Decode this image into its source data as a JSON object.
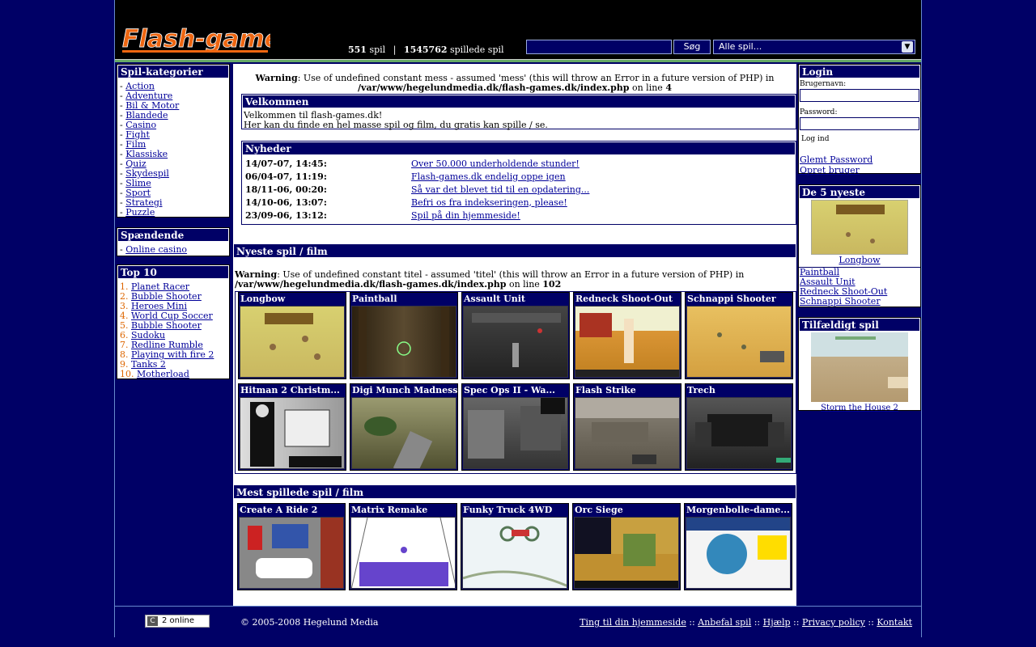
{
  "header": {
    "logo_text": "Flash-games",
    "stats": {
      "games_count": "551",
      "games_label": "spil",
      "separator": "|",
      "plays_count": "1545762",
      "plays_label": "spillede spil"
    },
    "search_button": "Søg",
    "category_select": "Alle spil..."
  },
  "sidebar_left": {
    "categories_title": "Spil-kategorier",
    "categories": [
      "Action",
      "Adventure",
      "Bil & Motor",
      "Blandede",
      "Casino",
      "Fight",
      "Film",
      "Klassiske",
      "Quiz",
      "Skydespil",
      "Slime",
      "Sport",
      "Strategi",
      "Puzzle"
    ],
    "articles_title": "Spændende artikler",
    "articles": [
      "Online casino"
    ],
    "top10_title": "Top 10",
    "top10": [
      "Planet Racer",
      "Bubble Shooter",
      "Heroes Mini",
      "World Cup Soccer",
      "Bubble Shooter",
      "Sudoku",
      "Redline Rumble",
      "Playing with fire 2",
      "Tanks 2",
      "Motherload"
    ]
  },
  "main": {
    "warning1": {
      "label": "Warning",
      "text": ": Use of undefined constant mess - assumed 'mess' (this will throw an Error in a future version of PHP) in ",
      "path": "/var/www/hegelundmedia.dk/flash-games.dk/index.php",
      "online": " on line ",
      "line": "4"
    },
    "welcome_title": "Velkommen",
    "welcome_line1": "Velkommen til flash-games.dk!",
    "welcome_line2": "Her kan du finde en hel masse spil og film, du gratis kan spille / se.",
    "news_title": "Nyheder",
    "news": [
      {
        "date": "14/07-07, 14:45:",
        "text": "Over 50.000 underholdende stunder!"
      },
      {
        "date": "06/04-07, 11:19:",
        "text": "Flash-games.dk endelig oppe igen"
      },
      {
        "date": "18/11-06, 00:20:",
        "text": "Så var det blevet tid til en opdatering..."
      },
      {
        "date": "14/10-06, 13:07:",
        "text": "Befri os fra indekseringen, please!"
      },
      {
        "date": "23/09-06, 13:12:",
        "text": "Spil på din hjemmeside!"
      }
    ],
    "newest_title": "Nyeste spil / film",
    "warning2": {
      "label": "Warning",
      "text": ": Use of undefined constant titel - assumed 'titel' (this will throw an Error in a future version of PHP) in ",
      "path": "/var/www/hegelundmedia.dk/flash-games.dk/index.php",
      "online": " on line ",
      "line": "102"
    },
    "newest_games": [
      "Longbow",
      "Paintball",
      "Assault Unit",
      "Redneck Shoot-Out",
      "Schnappi Shooter",
      "Hitman 2 Christm...",
      "Digi Munch Madness",
      "Spec Ops II - Wa...",
      "Flash Strike",
      "Trech"
    ],
    "most_played_title": "Mest spillede spil / film",
    "most_played": [
      "Create A Ride 2",
      "Matrix Remake",
      "Funky Truck 4WD",
      "Orc Siege",
      "Morgenbolle-dame..."
    ]
  },
  "sidebar_right": {
    "login_title": "Login",
    "username_label": "Brugernavn:",
    "password_label": "Password:",
    "login_button": "Log ind",
    "forgot_link": "Glemt Password",
    "create_link": "Opret bruger",
    "newest5_title": "De 5 nyeste",
    "newest5_featured": "Longbow",
    "newest5_list": [
      "Paintball",
      "Assault Unit",
      "Redneck Shoot-Out",
      "Schnappi Shooter"
    ],
    "random_title": "Tilfældigt spil",
    "random_game": "Storm the House 2"
  },
  "footer": {
    "online_badge": "2 online",
    "online_badge_icon": "C",
    "copyright": "© 2005-2008 Hegelund Media",
    "links": [
      "Ting til din hjemmeside",
      "Anbefal spil",
      "Hjælp",
      "Privacy policy",
      "Kontakt"
    ],
    "link_separator": "::"
  },
  "colors": {
    "navy": "#000066",
    "white": "#ffffff",
    "link": "#000099",
    "rank_number": "#dd6600",
    "logo_orange": "#ee6611"
  }
}
